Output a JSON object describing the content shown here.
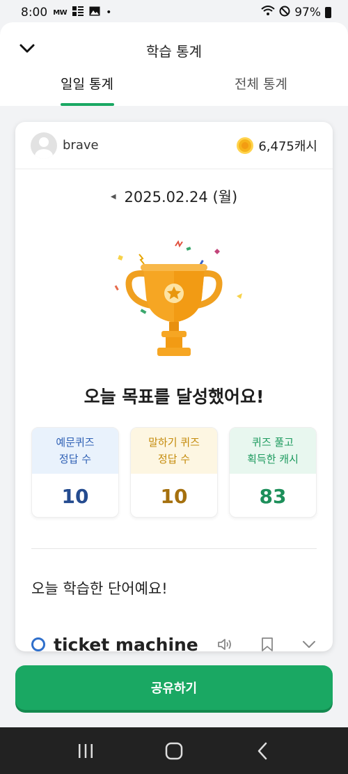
{
  "status_bar": {
    "time": "8:00",
    "carrier_glyph": "MW",
    "battery": "97%"
  },
  "header": {
    "title": "학습 통계",
    "tabs": [
      "일일 통계",
      "전체 통계"
    ],
    "active_tab": 0
  },
  "user": {
    "name": "brave",
    "cash": "6,475캐시"
  },
  "date": "2025.02.24 (월)",
  "goal_message": "오늘 목표를 달성했어요!",
  "stats": [
    {
      "line1": "예문퀴즈",
      "line2": "정답 수",
      "value": "10"
    },
    {
      "line1": "말하기 퀴즈",
      "line2": "정답 수",
      "value": "10"
    },
    {
      "line1": "퀴즈 풀고",
      "line2": "획득한 캐시",
      "value": "83"
    }
  ],
  "learned_section": {
    "title": "오늘 학습한 단어예요!",
    "words": [
      {
        "text": "ticket machine"
      }
    ]
  },
  "share_button": "공유하기",
  "colors": {
    "accent": "#1aa863",
    "stat_blue": "#2d5fb4",
    "stat_yellow": "#c48a0a",
    "stat_green": "#1c9a5e",
    "trophy": "#f6a623"
  },
  "icons": [
    "back-chevron-icon",
    "coin-icon",
    "date-prev-icon",
    "trophy-icon",
    "speaker-icon",
    "bookmark-icon",
    "expand-chevron-icon",
    "nav-recents-icon",
    "nav-home-icon",
    "nav-back-icon"
  ]
}
